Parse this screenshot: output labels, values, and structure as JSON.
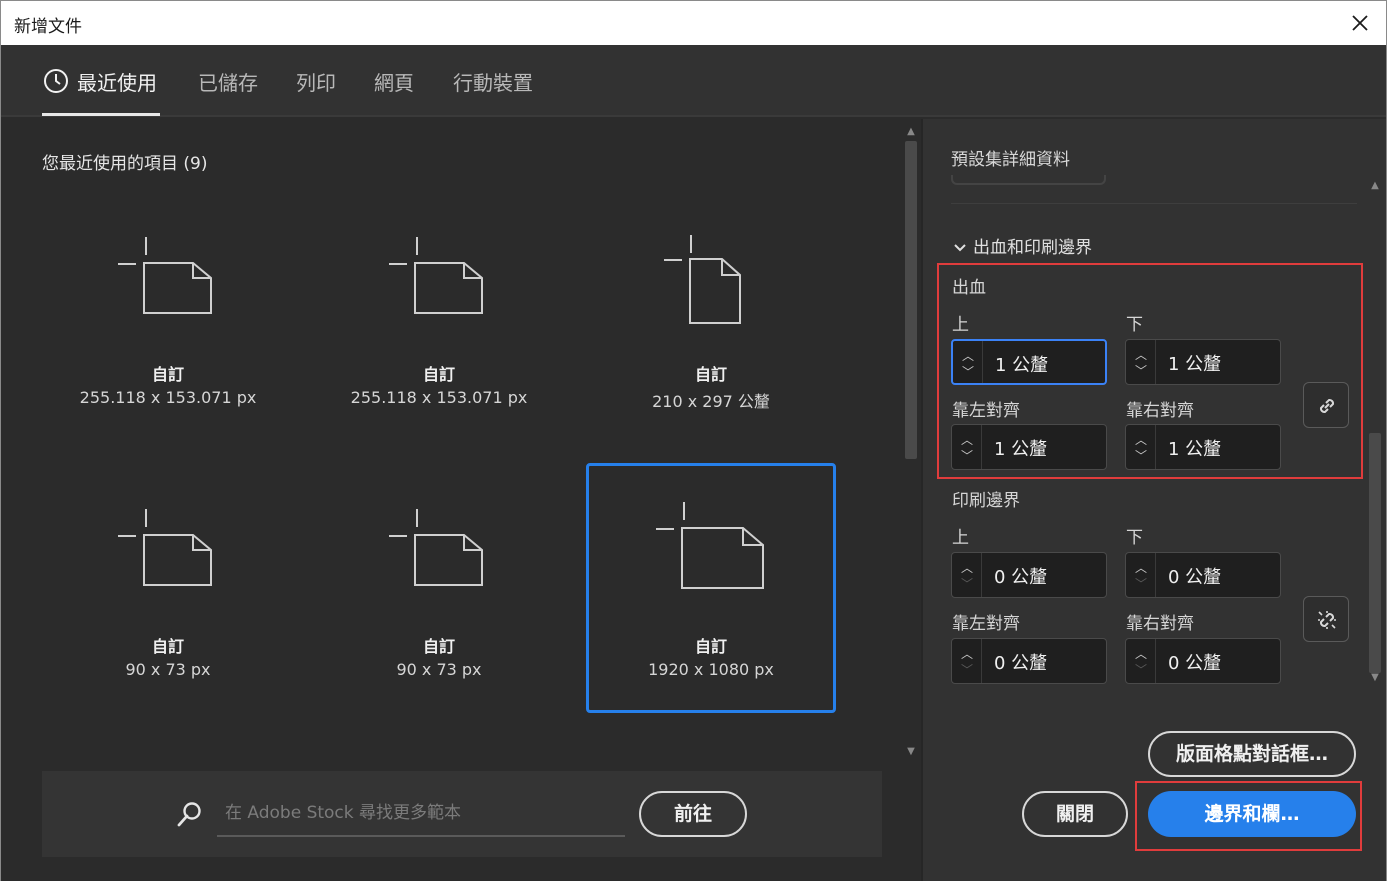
{
  "dialog": {
    "title": "新增文件"
  },
  "tabs": [
    {
      "label": "最近使用",
      "icon": "clock-icon",
      "active": true
    },
    {
      "label": "已儲存"
    },
    {
      "label": "列印"
    },
    {
      "label": "網頁"
    },
    {
      "label": "行動裝置"
    }
  ],
  "recent": {
    "heading": "您最近使用的項目 (9)",
    "items": [
      {
        "name": "自訂",
        "dims": "255.118 x 153.071 px",
        "orientation": "landscape"
      },
      {
        "name": "自訂",
        "dims": "255.118 x 153.071 px",
        "orientation": "landscape"
      },
      {
        "name": "自訂",
        "dims": "210 x 297 公釐",
        "orientation": "portrait"
      },
      {
        "name": "自訂",
        "dims": "90 x 73 px",
        "orientation": "landscape"
      },
      {
        "name": "自訂",
        "dims": "90 x 73 px",
        "orientation": "landscape"
      },
      {
        "name": "自訂",
        "dims": "1920 x 1080 px",
        "orientation": "landscape",
        "selected": true
      }
    ]
  },
  "stock": {
    "placeholder": "在 Adobe Stock 尋找更多範本",
    "go_label": "前往"
  },
  "details": {
    "title": "預設集詳細資料",
    "section_label": "出血和印刷邊界",
    "bleed": {
      "label": "出血",
      "top_label": "上",
      "top_value": "1 公釐",
      "bottom_label": "下",
      "bottom_value": "1 公釐",
      "left_label": "靠左對齊",
      "left_value": "1 公釐",
      "right_label": "靠右對齊",
      "right_value": "1 公釐"
    },
    "slug": {
      "label": "印刷邊界",
      "top_label": "上",
      "top_value": "0 公釐",
      "bottom_label": "下",
      "bottom_value": "0 公釐",
      "left_label": "靠左對齊",
      "left_value": "0 公釐",
      "right_label": "靠右對齊",
      "right_value": "0 公釐"
    }
  },
  "buttons": {
    "layout_grid": "版面格點對話框…",
    "close": "關閉",
    "margins_columns": "邊界和欄…"
  },
  "colors": {
    "accent": "#2680eb",
    "highlight": "#e03c3c",
    "panel": "#323232",
    "background": "#2b2b2b"
  }
}
